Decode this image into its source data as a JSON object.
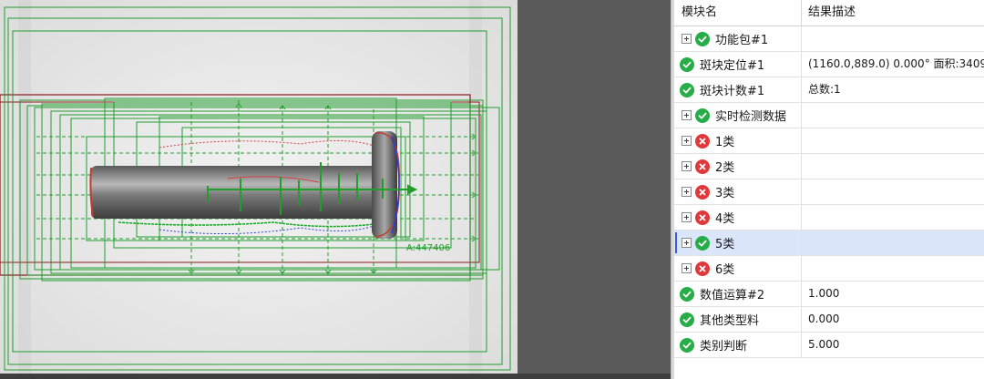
{
  "viewer": {
    "area_label": "A:447406"
  },
  "table": {
    "headers": {
      "module": "模块名",
      "result": "结果描述"
    },
    "rows": [
      {
        "name": "功能包#1",
        "result": "",
        "status": "ok",
        "expandable": true,
        "icon": "check-icon"
      },
      {
        "name": "斑块定位#1",
        "result": "(1160.0,889.0) 0.000° 面积:3409",
        "status": "ok",
        "expandable": false,
        "icon": "check-icon"
      },
      {
        "name": "斑块计数#1",
        "result": "总数:1",
        "status": "ok",
        "expandable": false,
        "icon": "check-icon"
      },
      {
        "name": "实时检测数据",
        "result": "",
        "status": "ok",
        "expandable": true,
        "icon": "check-icon"
      },
      {
        "name": "1类",
        "result": "",
        "status": "err",
        "expandable": true,
        "icon": "error-icon"
      },
      {
        "name": "2类",
        "result": "",
        "status": "err",
        "expandable": true,
        "icon": "error-icon"
      },
      {
        "name": "3类",
        "result": "",
        "status": "err",
        "expandable": true,
        "icon": "error-icon"
      },
      {
        "name": "4类",
        "result": "",
        "status": "err",
        "expandable": true,
        "icon": "error-icon"
      },
      {
        "name": "5类",
        "result": "",
        "status": "ok",
        "expandable": true,
        "icon": "check-icon",
        "selected": true
      },
      {
        "name": "6类",
        "result": "",
        "status": "err",
        "expandable": true,
        "icon": "error-icon"
      },
      {
        "name": "数值运算#2",
        "result": "1.000",
        "status": "ok",
        "expandable": false,
        "icon": "check-icon"
      },
      {
        "name": "其他类型料",
        "result": "0.000",
        "status": "ok",
        "expandable": false,
        "icon": "check-icon"
      },
      {
        "name": "类别判断",
        "result": "5.000",
        "status": "ok",
        "expandable": false,
        "icon": "check-icon"
      }
    ]
  },
  "colors": {
    "ok": "#27ad47",
    "err": "#e0393b",
    "overlay_green": "#1f9e2a",
    "overlay_red": "#8b1a1a",
    "selection": "#dce6fb"
  }
}
